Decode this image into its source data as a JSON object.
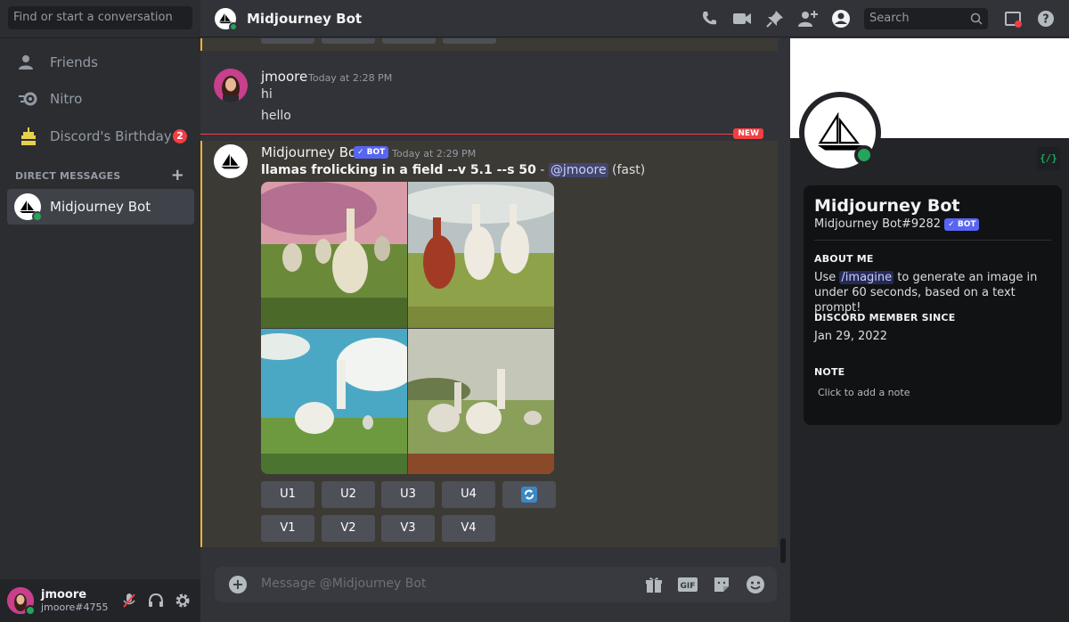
{
  "sidebar": {
    "search_placeholder": "Find or start a conversation",
    "nav": [
      {
        "label": "Friends"
      },
      {
        "label": "Nitro"
      },
      {
        "label": "Discord's Birthday",
        "badge": "2"
      }
    ],
    "dm_header": "DIRECT MESSAGES",
    "dm_plus": "+",
    "dms": [
      {
        "label": "Midjourney Bot"
      }
    ]
  },
  "user_panel": {
    "name": "jmoore",
    "tag": "jmoore#4755"
  },
  "topbar": {
    "title": "Midjourney Bot",
    "search_placeholder": "Search"
  },
  "messages": {
    "user_msg": {
      "author": "jmoore",
      "time": "Today at 2:28 PM",
      "lines": [
        "hi",
        "hello"
      ]
    },
    "new_label": "NEW",
    "bot_msg": {
      "author": "Midjourney Bot",
      "bot_tag": "✓ BOT",
      "time": "Today at 2:29 PM",
      "prompt": "llamas frolicking in a field --v 5.1 --s 50",
      "sep": " - ",
      "mention": "@jmoore",
      "speed": " (fast)"
    },
    "buttons_row1": [
      "U1",
      "U2",
      "U3",
      "U4"
    ],
    "buttons_row2": [
      "V1",
      "V2",
      "V3",
      "V4"
    ]
  },
  "composer": {
    "placeholder": "Message @Midjourney Bot"
  },
  "profile": {
    "name": "Midjourney Bot",
    "tag": "Midjourney Bot#9282",
    "bot_tag": "✓ BOT",
    "dev_badge": "{/}",
    "about_head": "ABOUT ME",
    "about_pre": "Use ",
    "about_cmd": "/imagine",
    "about_post": " to generate an image in under 60 seconds, based on a text prompt!",
    "since_head": "DISCORD MEMBER SINCE",
    "since_value": "Jan 29, 2022",
    "note_head": "NOTE",
    "note_placeholder": "Click to add a note"
  },
  "colors": {
    "accent": "#5865f2",
    "online": "#23a55a",
    "mention_highlight": "#f0b232",
    "danger": "#f23f43"
  },
  "icons": [
    "friends-icon",
    "nitro-icon",
    "birthday-cake-icon",
    "phone-icon",
    "video-icon",
    "pin-icon",
    "add-friend-icon",
    "profile-icon",
    "search-icon",
    "inbox-icon",
    "help-icon",
    "gift-icon",
    "gif-icon",
    "sticker-icon",
    "emoji-icon",
    "mute-mic-icon",
    "headset-icon",
    "gear-icon",
    "refresh-icon"
  ]
}
